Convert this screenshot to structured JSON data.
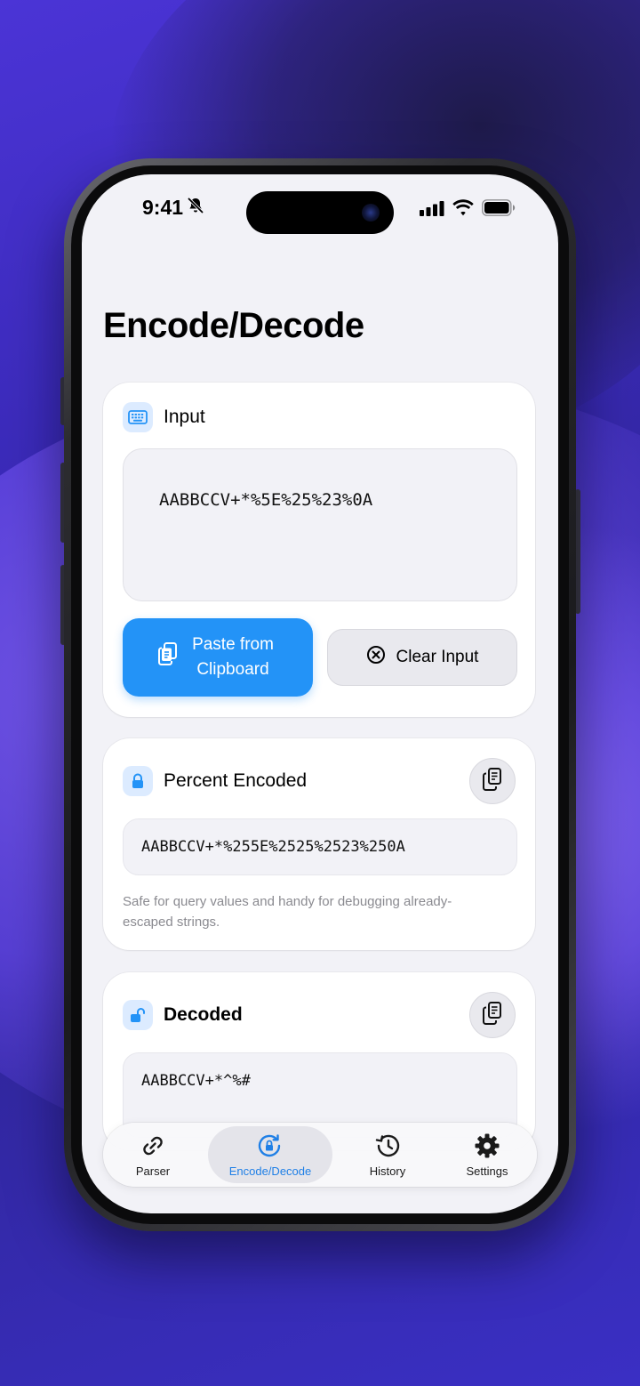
{
  "status": {
    "time": "9:41"
  },
  "page": {
    "title": "Encode/Decode"
  },
  "input_card": {
    "title": "Input",
    "value": "AABBCCV+*%5E%25%23%0A",
    "paste_label_line1": "Paste from",
    "paste_label_line2": "Clipboard",
    "clear_label": "Clear Input"
  },
  "encoded_card": {
    "title": "Percent Encoded",
    "value": "AABBCCV+*%255E%2525%2523%250A",
    "hint": "Safe for query values and handy for debugging already-escaped strings."
  },
  "decoded_card": {
    "title": "Decoded",
    "value": "AABBCCV+*^%#"
  },
  "tabs": [
    {
      "label": "Parser",
      "icon": "link-icon"
    },
    {
      "label": "Encode/Decode",
      "icon": "lock-rotation-icon"
    },
    {
      "label": "History",
      "icon": "history-icon"
    },
    {
      "label": "Settings",
      "icon": "gear-icon"
    }
  ],
  "colors": {
    "accent": "#2393f7",
    "active_tab": "#1f7fe6",
    "screen_bg": "#f2f2f7"
  }
}
